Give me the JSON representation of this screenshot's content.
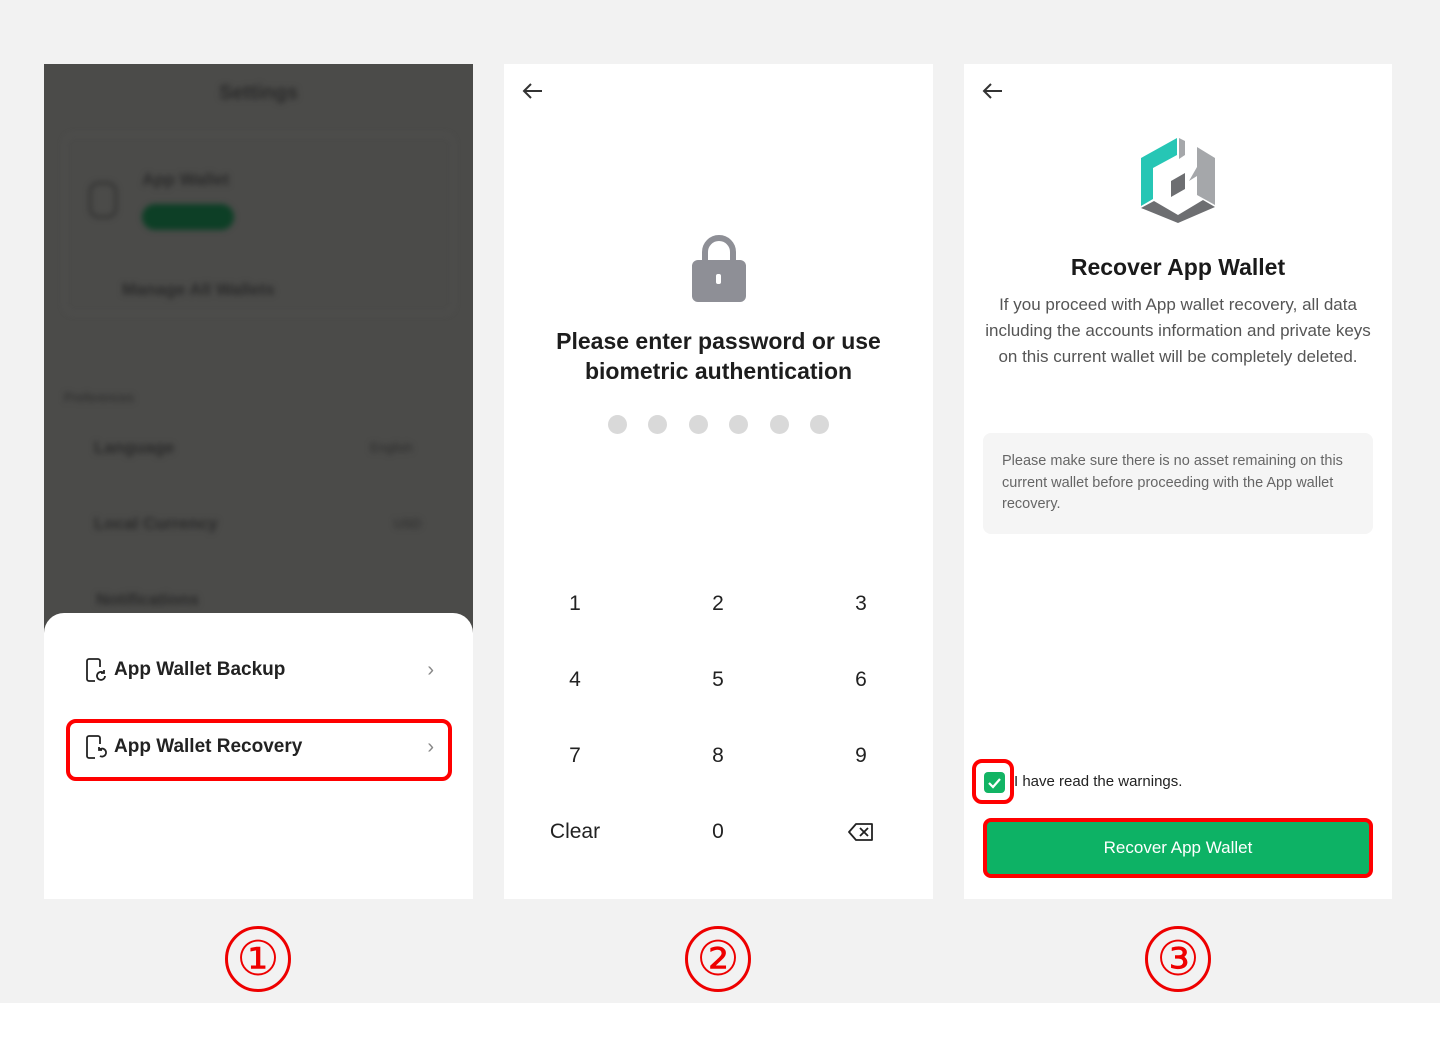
{
  "step1": {
    "background": {
      "title": "Settings",
      "wallet_name": "App Wallet",
      "manage": "Manage All Wallets",
      "section": "Preferences",
      "language": "Language",
      "language_value": "English",
      "currency": "Local Currency",
      "currency_value": "USD",
      "notifications": "Notifications"
    },
    "sheet": {
      "items": [
        {
          "label": "App Wallet Backup",
          "icon": "phone-backup-icon"
        },
        {
          "label": "App Wallet Recovery",
          "icon": "phone-restore-icon",
          "highlighted": true
        }
      ]
    }
  },
  "step2": {
    "title": "Please enter password or use biometric authentication",
    "pin_length": 6,
    "pin_filled": 0,
    "keys": [
      "1",
      "2",
      "3",
      "4",
      "5",
      "6",
      "7",
      "8",
      "9",
      "Clear",
      "0",
      "backspace-icon"
    ]
  },
  "step3": {
    "title": "Recover App Wallet",
    "description": "If you proceed with App wallet recovery, all data including the accounts information and private keys on this current wallet will be completely deleted.",
    "note": "Please make sure there is no asset remaining on this current wallet before proceeding with the App wallet recovery.",
    "checkbox_label": "I have read the warnings.",
    "checkbox_checked": true,
    "button": "Recover App Wallet"
  },
  "step_labels": [
    "①",
    "②",
    "③"
  ],
  "colors": {
    "accent": "#0db265",
    "highlight": "#ff0000",
    "logo_teal": "#26c6b5"
  }
}
